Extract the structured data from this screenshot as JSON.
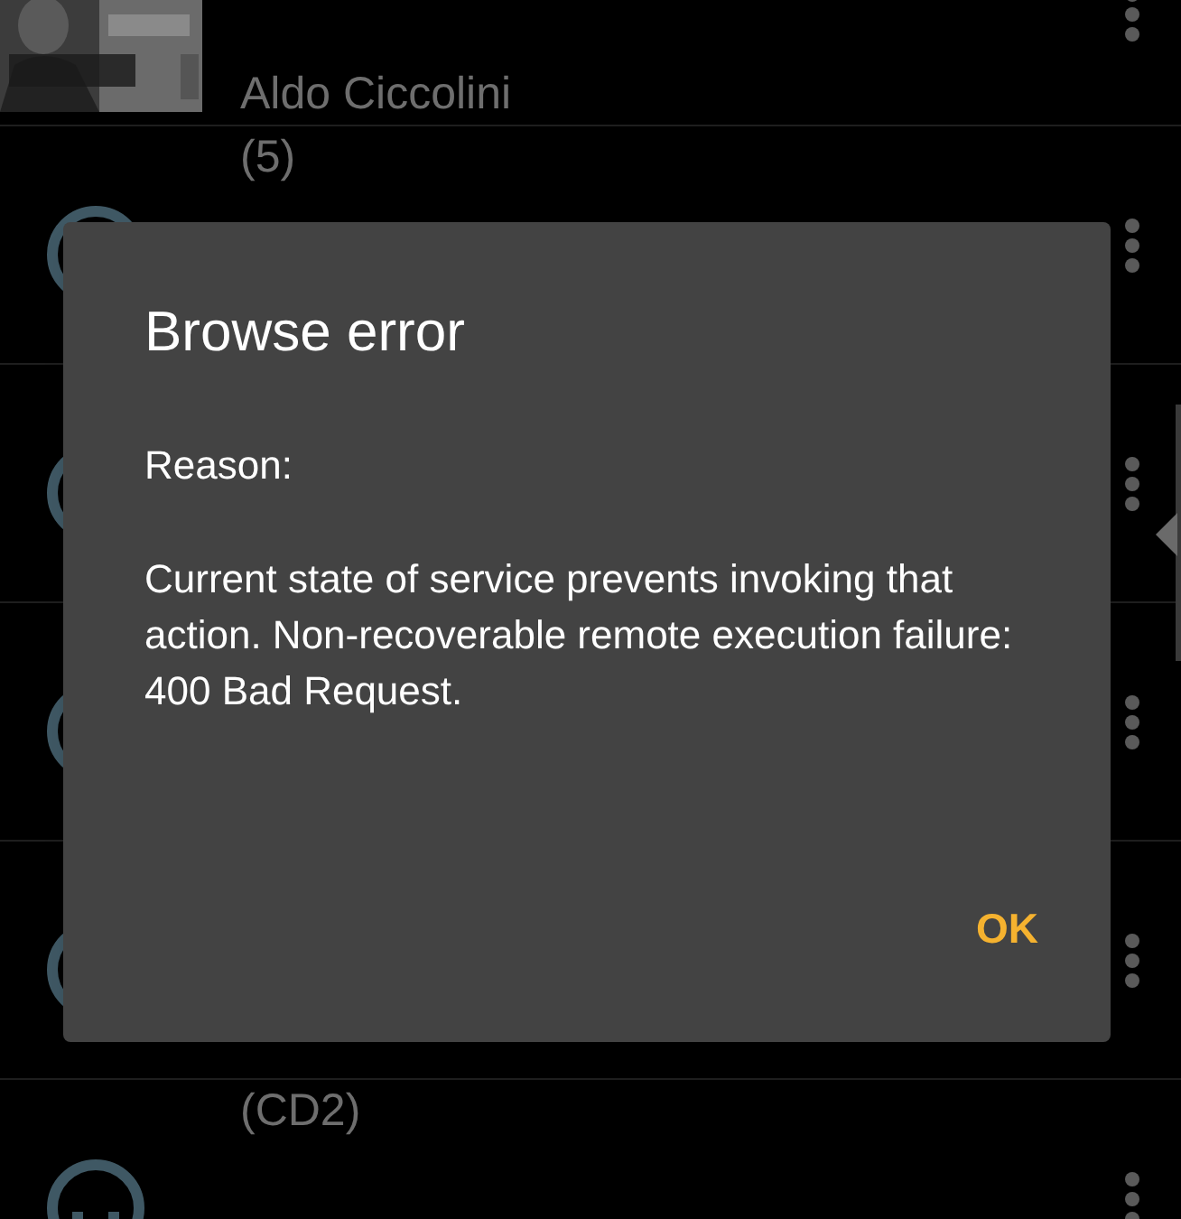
{
  "list": {
    "rows": [
      {
        "kind": "art",
        "title": "Aldo Ciccolini"
      },
      {
        "kind": "disc",
        "title": "(5)"
      },
      {
        "kind": "disc"
      },
      {
        "kind": "disc"
      },
      {
        "kind": "disc"
      },
      {
        "kind": "disc",
        "title": "(CD2)"
      }
    ]
  },
  "dialog": {
    "title": "Browse error",
    "label": "Reason:",
    "message": "Current state of service prevents invoking that action. Non-recoverable remote execution failure: 400 Bad Request.",
    "button": "OK"
  }
}
